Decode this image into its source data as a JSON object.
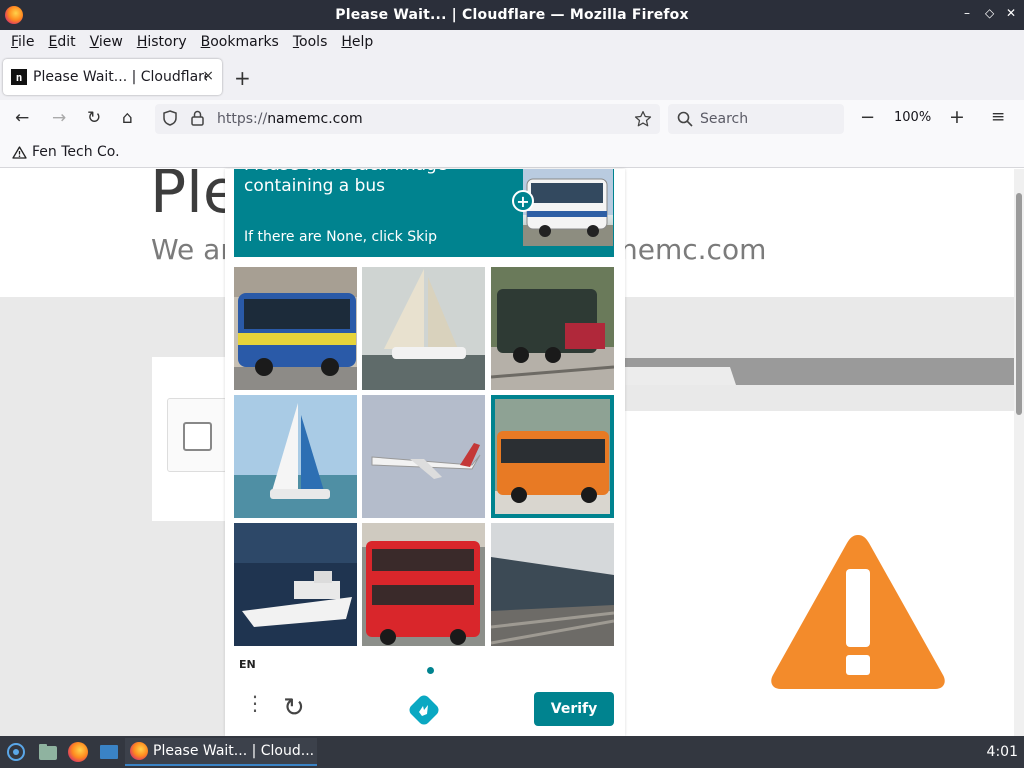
{
  "window": {
    "title": "Please Wait... | Cloudflare — Mozilla Firefox",
    "controls": [
      "✕",
      "◇",
      "–"
    ]
  },
  "menu": [
    "File",
    "Edit",
    "View",
    "History",
    "Bookmarks",
    "Tools",
    "Help"
  ],
  "tab": {
    "label": "Please Wait... | Cloudflare",
    "favicon": "n",
    "close": "×"
  },
  "newtab": "+",
  "nav": {
    "back": "←",
    "forward": "→",
    "reload": "↻",
    "home": "⌂",
    "url_scheme": "https://",
    "url_host": "namemc.com",
    "search_placeholder": "Search",
    "zoom_minus": "−",
    "zoom_level": "100%",
    "zoom_plus": "+",
    "menu": "≡"
  },
  "bookmarks": [
    {
      "label": "Fen Tech Co."
    }
  ],
  "page": {
    "heading_visible": "Ple",
    "subtitle_left": "We ar",
    "subtitle_right": "nemc.com"
  },
  "captcha": {
    "prompt": "Please click each image containing a bus",
    "skip_hint": "If there are None, click Skip",
    "tiles": [
      {
        "subject": "bus",
        "selected": false
      },
      {
        "subject": "sailboat",
        "selected": false
      },
      {
        "subject": "train",
        "selected": false
      },
      {
        "subject": "sailboat",
        "selected": false
      },
      {
        "subject": "airplane",
        "selected": false
      },
      {
        "subject": "bus",
        "selected": true
      },
      {
        "subject": "yacht",
        "selected": false
      },
      {
        "subject": "bus",
        "selected": false
      },
      {
        "subject": "train",
        "selected": false
      }
    ],
    "language": "EN",
    "more_icon": "⋮",
    "refresh_icon": "↻",
    "verify_label": "Verify"
  },
  "taskbar": {
    "task_label": "Please Wait... | Cloud...",
    "clock": "4:01"
  },
  "colors": {
    "teal": "#00838f",
    "warning": "#f38b2b"
  }
}
